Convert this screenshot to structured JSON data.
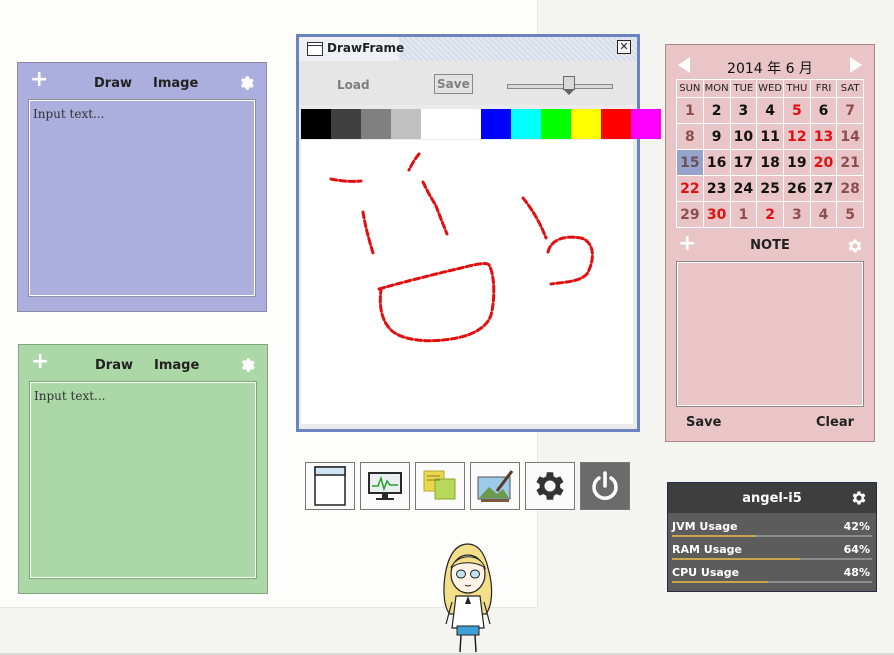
{
  "note_blue": {
    "draw_label": "Draw",
    "image_label": "Image",
    "placeholder": "Input text..."
  },
  "note_green": {
    "draw_label": "Draw",
    "image_label": "Image",
    "placeholder": "Input text..."
  },
  "draw_frame": {
    "title": "DrawFrame",
    "load_label": "Load",
    "save_label": "Save",
    "brush_size_level": 0.58,
    "palette": [
      "#000000",
      "#404040",
      "#808080",
      "#c0c0c0",
      "#ffffff",
      "",
      "#0000ff",
      "#00ffff",
      "#00ff00",
      "#ffff00",
      "#ff0000",
      "#ff00ff"
    ]
  },
  "dock": {
    "icons": [
      "window-icon",
      "activity-monitor-icon",
      "sticky-notes-icon",
      "image-paint-icon",
      "settings-gear-icon",
      "power-icon"
    ]
  },
  "calendar": {
    "title": "2014 年  6 月",
    "weekdays": [
      "SUN",
      "MON",
      "TUE",
      "WED",
      "THU",
      "FRI",
      "SAT"
    ],
    "weeks": [
      [
        "1",
        "2",
        "3",
        "4",
        "5",
        "6",
        "7"
      ],
      [
        "8",
        "9",
        "10",
        "11",
        "12",
        "13",
        "14"
      ],
      [
        "15",
        "16",
        "17",
        "18",
        "19",
        "20",
        "21"
      ],
      [
        "22",
        "23",
        "24",
        "25",
        "26",
        "27",
        "28"
      ],
      [
        "29",
        "30",
        "1",
        "2",
        "3",
        "4",
        "5"
      ]
    ],
    "today": "15",
    "note_title": "NOTE",
    "save_label": "Save",
    "clear_label": "Clear"
  },
  "monitor": {
    "title": "angel-i5",
    "rows": [
      {
        "label": "JVM Usage",
        "value": "42%",
        "fraction": 0.42
      },
      {
        "label": "RAM Usage",
        "value": "64%",
        "fraction": 0.64
      },
      {
        "label": "CPU Usage",
        "value": "48%",
        "fraction": 0.48
      }
    ]
  },
  "colors": {
    "stroke": "#e01010",
    "frame_border": "#6b84bd",
    "blue_note": "#acaedd",
    "green_note": "#acd8a8",
    "calendar": "#e9c5c8"
  }
}
